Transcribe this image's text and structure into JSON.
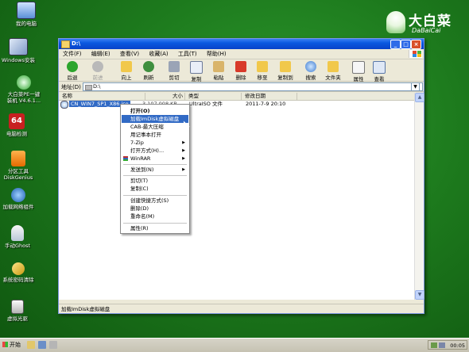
{
  "desktop": {
    "icons": [
      {
        "label": "我的电脑",
        "icon": "computer-icon"
      },
      {
        "label": "Windows安装",
        "icon": "windows-setup-icon"
      },
      {
        "label": "大白菜PE一键\n装机 V4.6.1...",
        "icon": "dabaicai-install-icon"
      },
      {
        "label": "电脑检测",
        "icon": "pc-check-icon"
      },
      {
        "label": "分区工具\nDiskGenius",
        "icon": "diskgenius-icon"
      },
      {
        "label": "加载网络组件",
        "icon": "network-icon"
      },
      {
        "label": "手动Ghost",
        "icon": "ghost-icon"
      },
      {
        "label": "系统密码清除",
        "icon": "password-key-icon"
      },
      {
        "label": "虚拟光驱",
        "icon": "virtual-drive-icon"
      }
    ],
    "logo": {
      "cn": "大白菜",
      "en": "DaBaiCai"
    }
  },
  "window": {
    "title": "D:\\",
    "menu": [
      "文件(F)",
      "编辑(E)",
      "查看(V)",
      "收藏(A)",
      "工具(T)",
      "帮助(H)"
    ],
    "toolbar": [
      {
        "label": "后退",
        "icon": "back-icon"
      },
      {
        "label": "前进",
        "icon": "forward-icon"
      },
      {
        "label": "向上",
        "icon": "up-folder-icon"
      },
      {
        "label": "刷新",
        "icon": "refresh-icon"
      },
      {
        "label": "剪切",
        "icon": "cut-icon"
      },
      {
        "label": "复制",
        "icon": "copy-icon"
      },
      {
        "label": "粘贴",
        "icon": "paste-icon"
      },
      {
        "label": "删除",
        "icon": "delete-icon"
      },
      {
        "label": "移至",
        "icon": "move-to-icon"
      },
      {
        "label": "复制到",
        "icon": "copy-to-icon"
      },
      {
        "label": "搜索",
        "icon": "search-icon"
      },
      {
        "label": "文件夹",
        "icon": "folders-icon"
      },
      {
        "label": "属性",
        "icon": "properties-icon"
      },
      {
        "label": "查看",
        "icon": "views-icon"
      }
    ],
    "address_label": "地址(D)",
    "address_value": "D:\\",
    "columns": [
      "名称",
      "大小",
      "类型",
      "修改日期"
    ],
    "files": [
      {
        "name": "CN_WIN7_SP1_X86.iso",
        "size": "3,107,008 KB",
        "type": "UltraISO 文件",
        "date": "2011-7-9 20:10"
      }
    ],
    "status": "加载ImDisk虚拟磁盘"
  },
  "context_menu": {
    "items": [
      "打开(O)",
      "加载ImDisk虚拟磁盘",
      "CAB-最大压缩",
      "用记事本打开",
      "7-Zip",
      "打开方式(H)...",
      "WinRAR",
      "发送到(N)",
      "剪切(T)",
      "复制(C)",
      "创建快捷方式(S)",
      "删除(D)",
      "重命名(M)",
      "属性(R)"
    ],
    "highlighted": "加载ImDisk虚拟磁盘"
  },
  "taskbar": {
    "start_label": "开始",
    "clock": "00:05"
  }
}
